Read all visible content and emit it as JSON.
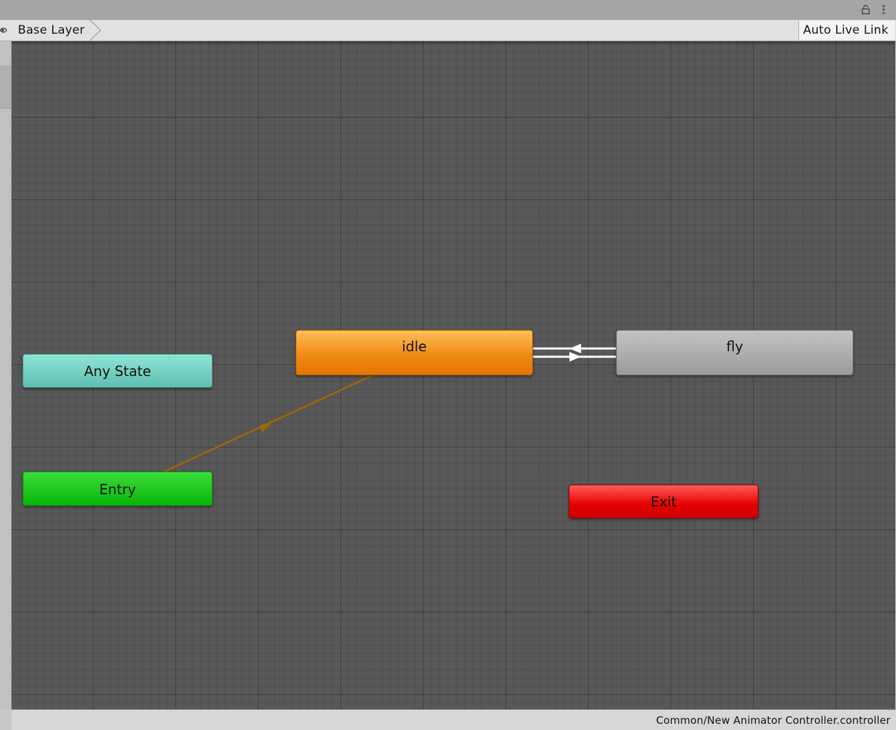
{
  "breadcrumb": {
    "layer_label": "Base Layer"
  },
  "toolbar": {
    "auto_live_link_label": "Auto Live Link"
  },
  "icons": {
    "lock": "lock-icon",
    "menu": "kebab-menu-icon",
    "eye": "eye-icon"
  },
  "states": {
    "any_state": {
      "label": "Any State",
      "color": "#7dd6c6"
    },
    "entry": {
      "label": "Entry",
      "color": "#1ccb1c"
    },
    "idle": {
      "label": "idle",
      "color": "#f0900e",
      "is_default": true
    },
    "fly": {
      "label": "fly",
      "color": "#b0b0b0"
    },
    "exit": {
      "label": "Exit",
      "color": "#e41010"
    }
  },
  "transitions": [
    {
      "from": "Entry",
      "to": "idle",
      "color": "#a06800"
    },
    {
      "from": "idle",
      "to": "fly",
      "color": "#ffffff"
    },
    {
      "from": "fly",
      "to": "idle",
      "color": "#ffffff"
    }
  ],
  "status": {
    "asset_path": "Common/New Animator Controller.controller"
  }
}
